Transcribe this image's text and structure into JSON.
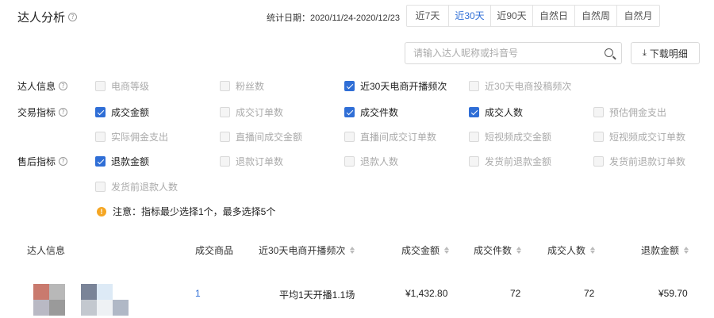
{
  "header": {
    "title": "达人分析",
    "date_label": "统计日期：2020/11/24-2020/12/23",
    "tabs": [
      "近7天",
      "近30天",
      "近90天",
      "自然日",
      "自然周",
      "自然月"
    ],
    "active_tab": "近30天"
  },
  "search": {
    "placeholder": "请输入达人昵称或抖音号"
  },
  "download_label": "下载明细",
  "rows": [
    {
      "label": "达人信息"
    },
    {
      "label": "交易指标"
    },
    {
      "label": "售后指标"
    }
  ],
  "metrics": {
    "influencer": [
      {
        "label": "电商等级",
        "checked": false
      },
      {
        "label": "粉丝数",
        "checked": false
      },
      {
        "label": "近30天电商开播频次",
        "checked": true
      },
      {
        "label": "近30天电商投稿频次",
        "checked": false
      }
    ],
    "trade": [
      {
        "label": "成交金额",
        "checked": true
      },
      {
        "label": "成交订单数",
        "checked": false
      },
      {
        "label": "成交件数",
        "checked": true
      },
      {
        "label": "成交人数",
        "checked": true
      },
      {
        "label": "预估佣金支出",
        "checked": false
      },
      {
        "label": "实际佣金支出",
        "checked": false
      },
      {
        "label": "直播间成交金额",
        "checked": false
      },
      {
        "label": "直播间成交订单数",
        "checked": false
      },
      {
        "label": "短视频成交金额",
        "checked": false
      },
      {
        "label": "短视频成交订单数",
        "checked": false
      }
    ],
    "aftersale": [
      {
        "label": "退款金额",
        "checked": true
      },
      {
        "label": "退款订单数",
        "checked": false
      },
      {
        "label": "退款人数",
        "checked": false
      },
      {
        "label": "发货前退款金额",
        "checked": false
      },
      {
        "label": "发货前退款订单数",
        "checked": false
      },
      {
        "label": "发货前退款人数",
        "checked": false
      }
    ]
  },
  "note": "注意：指标最少选择1个，最多选择5个",
  "table": {
    "headers": [
      "达人信息",
      "成交商品",
      "近30天电商开播频次",
      "成交金额",
      "成交件数",
      "成交人数",
      "退款金额"
    ],
    "row": {
      "products": "1",
      "frequency": "平均1天开播1.1场",
      "amount": "¥1,432.80",
      "items": "72",
      "buyers": "72",
      "refund": "¥59.70"
    }
  },
  "colors": {
    "accent": "#2f6ed6",
    "warning": "#f5a623"
  }
}
